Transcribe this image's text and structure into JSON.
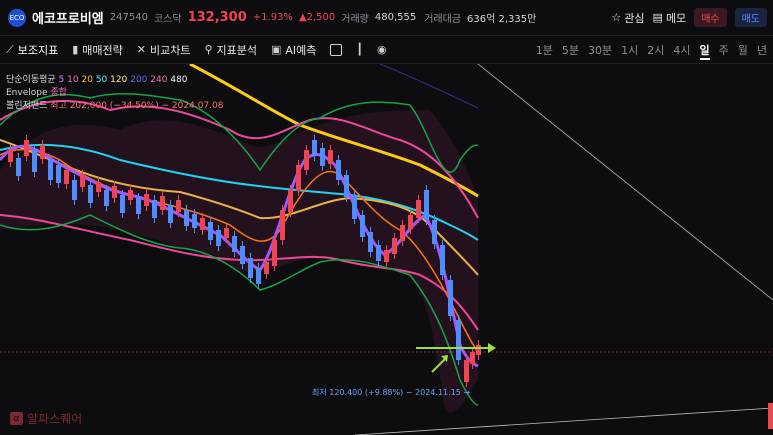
{
  "header": {
    "logo_text": "ECO",
    "stock_name": "에코프로비엠",
    "code": "247540",
    "market": "코스닥",
    "price": "132,300",
    "change_pct": "+1.93%",
    "change_abs": "▲2,500",
    "volume_label": "거래량",
    "volume": "480,555",
    "amount_label": "거래대금",
    "amount": "636억 2,335만",
    "interest_label": "관심",
    "memo_label": "메모",
    "buy_label": "매수",
    "sell_label": "매도"
  },
  "toolbar": {
    "tools": [
      "보조지표",
      "매매전략",
      "비교차트",
      "지표분석",
      "AI예측"
    ],
    "periods": [
      "1분",
      "5분",
      "30분",
      "1시",
      "2시",
      "4시",
      "일",
      "주",
      "월",
      "년"
    ],
    "selected_period": "일"
  },
  "legend": {
    "ma_label": "단순이동평균",
    "ma_values": [
      "5",
      "10",
      "20",
      "50",
      "120",
      "200",
      "240",
      "480"
    ],
    "envelope_label": "Envelope",
    "envelope_extra": "종합",
    "bollinger_label": "볼린저밴드",
    "high_text": "최고 202,000 (−34.50%) − 2024.07.08"
  },
  "annotations": {
    "low_text": "최저 120.400 (+9.88%) − 2024.11.15 →"
  },
  "watermark": {
    "text": "알파스퀘어"
  },
  "colors": {
    "up": "#f04452",
    "down": "#4f8cff",
    "ma5": "#a855f7",
    "ma10": "#f97316",
    "ma20": "#e8b04a",
    "ma50": "#22d3ee",
    "ma120": "#facc15",
    "envelope": "#ec4899",
    "bollinger": "#16a34a"
  }
}
